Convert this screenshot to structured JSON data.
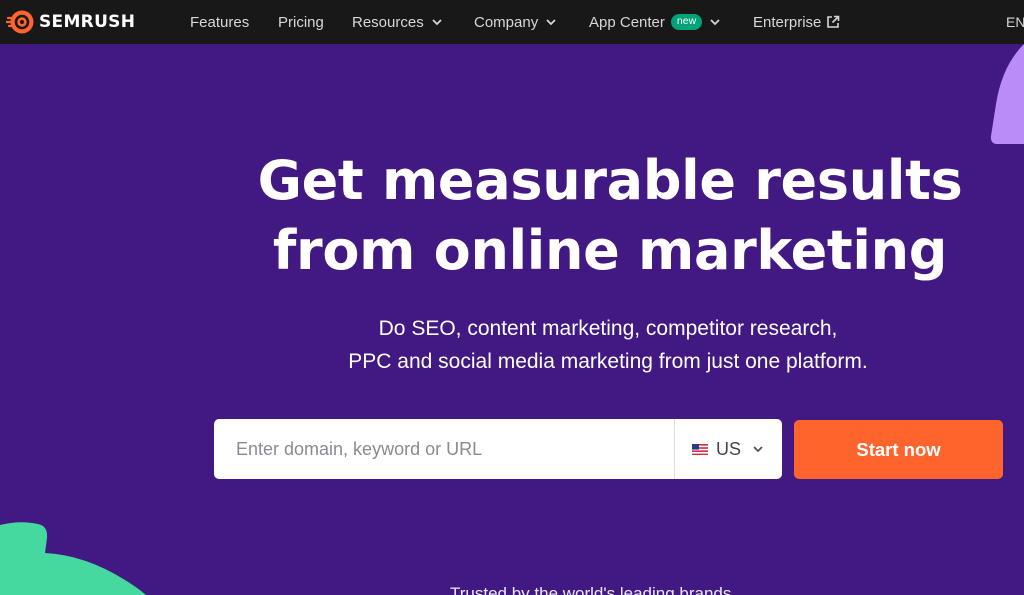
{
  "brand": {
    "name": "SEMRUSH",
    "logo_icon": "semrush-fireball-icon",
    "accent": "#ff642d"
  },
  "nav": {
    "items": [
      {
        "label": "Features"
      },
      {
        "label": "Pricing"
      },
      {
        "label": "Resources",
        "icon": "chevron-down-icon"
      },
      {
        "label": "Company",
        "icon": "chevron-down-icon"
      },
      {
        "label": "App Center",
        "badge": "new",
        "icon": "chevron-down-icon"
      },
      {
        "label": "Enterprise",
        "icon": "external-link-icon"
      }
    ],
    "language": "EN"
  },
  "hero": {
    "title_line1": "Get measurable results",
    "title_line2": "from online marketing",
    "subtitle_line1": "Do SEO, content marketing, competitor research,",
    "subtitle_line2": "PPC and social media marketing from just one platform."
  },
  "search": {
    "placeholder": "Enter domain, keyword or URL",
    "value": "",
    "country": "US",
    "country_icon": "us-flag-icon",
    "submit_label": "Start now"
  },
  "trusted_text": "Trusted by the world's leading brands",
  "colors": {
    "background": "#421983",
    "nav_background": "#181818",
    "button": "#ff642d",
    "badge": "#00a37a",
    "deco_purple": "#b98cf7",
    "deco_green": "#45d9a0"
  }
}
